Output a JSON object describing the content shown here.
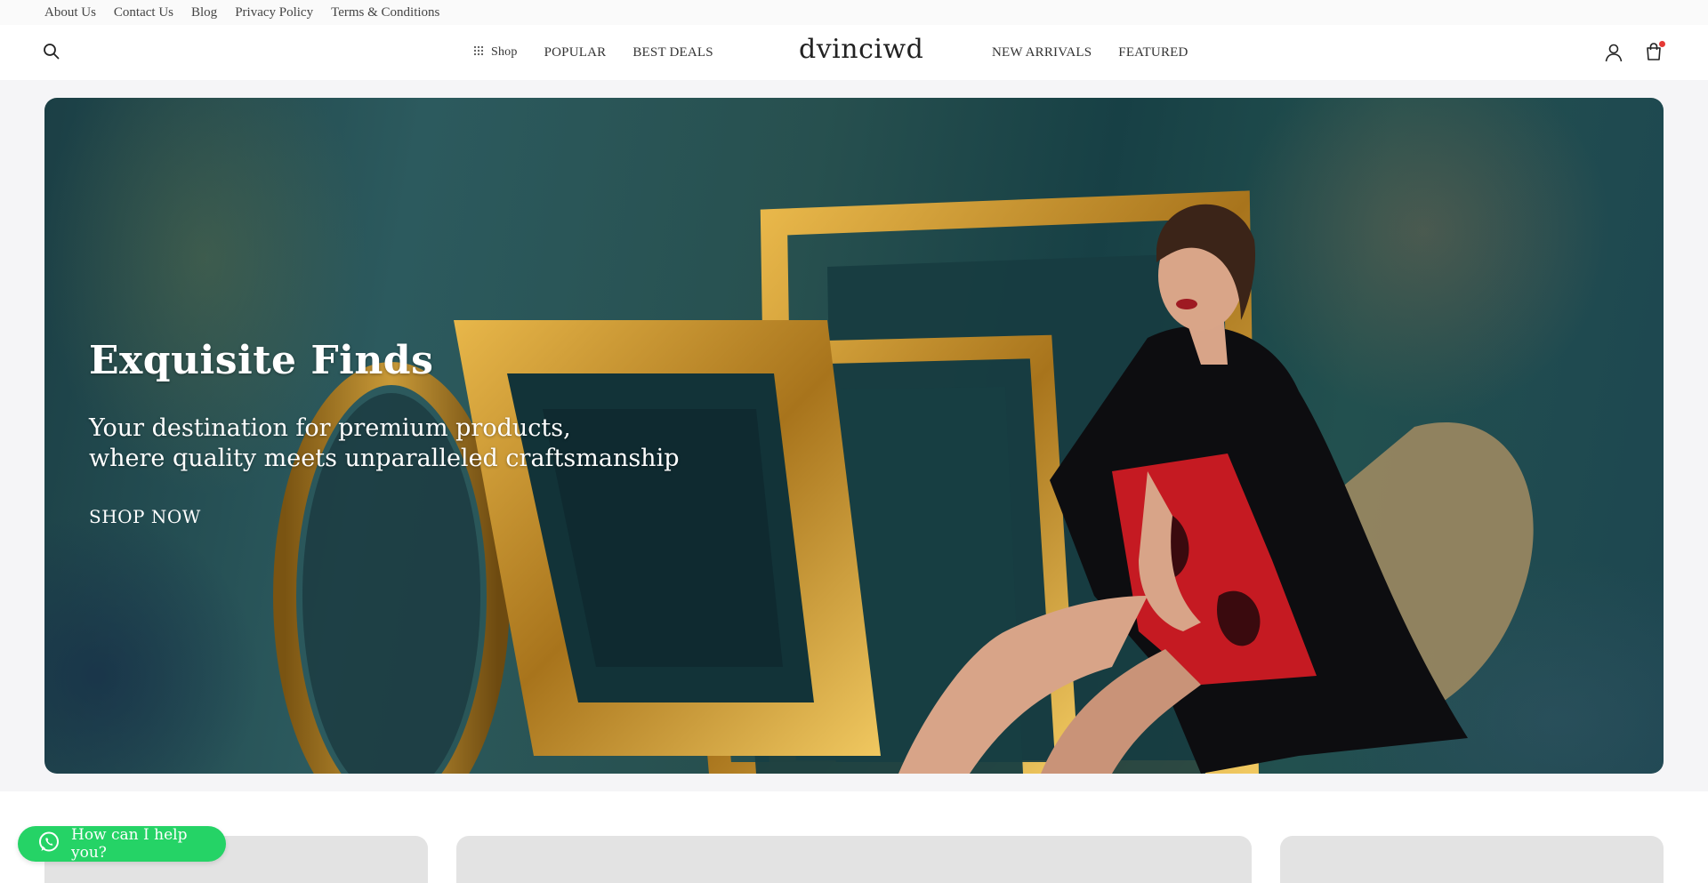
{
  "utility_links": [
    {
      "label": "About Us"
    },
    {
      "label": "Contact Us"
    },
    {
      "label": "Blog"
    },
    {
      "label": "Privacy Policy"
    },
    {
      "label": "Terms & Conditions"
    }
  ],
  "header": {
    "logo": "dvinciwd",
    "nav_left": [
      {
        "label": "Shop",
        "icon": "grid-icon"
      },
      {
        "label": "POPULAR"
      },
      {
        "label": "BEST DEALS"
      }
    ],
    "nav_right": [
      {
        "label": "NEW ARRIVALS"
      },
      {
        "label": "FEATURED"
      }
    ],
    "icons": {
      "search": "search-icon",
      "account": "user-icon",
      "cart": "shopping-bag-icon"
    },
    "cart_badge_color": "#e53935"
  },
  "hero": {
    "title": "Exquisite Finds",
    "subtitle_line1": "Your destination for premium products,",
    "subtitle_line2": "where quality meets unparalleled craftsmanship",
    "cta": "SHOP NOW"
  },
  "chat": {
    "label": "How can I help you?",
    "icon": "whatsapp-icon",
    "color": "#25d366"
  }
}
